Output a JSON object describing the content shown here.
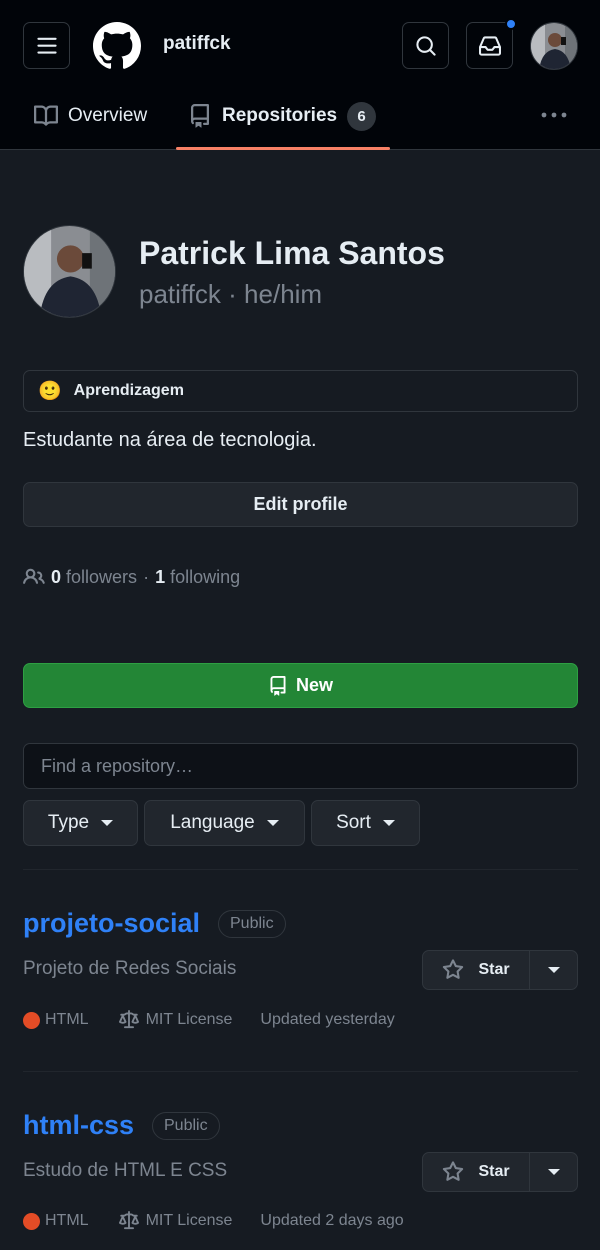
{
  "header": {
    "username": "patiffck",
    "inbox_has_unread": true
  },
  "tabs": [
    {
      "label": "Overview",
      "icon": "book-icon"
    },
    {
      "label": "Repositories",
      "icon": "repo-icon",
      "count": "6",
      "selected": true
    }
  ],
  "profile": {
    "full_name": "Patrick Lima Santos",
    "login": "patiffck",
    "pronouns": "he/him",
    "separator": "·",
    "status_emoji": "🙂",
    "status_text": "Aprendizagem",
    "bio": "Estudante na área de tecnologia.",
    "edit_label": "Edit profile",
    "followers_count": "0",
    "followers_label": "followers",
    "following_count": "1",
    "following_label": "following"
  },
  "repo_toolbar": {
    "new_label": "New",
    "search_placeholder": "Find a repository…",
    "filters": [
      "Type",
      "Language",
      "Sort"
    ]
  },
  "repos": [
    {
      "name": "projeto-social",
      "visibility": "Public",
      "description": "Projeto de Redes Sociais",
      "star_label": "Star",
      "language": "HTML",
      "language_color": "#e34c26",
      "license": "MIT License",
      "updated": "Updated yesterday"
    },
    {
      "name": "html-css",
      "visibility": "Public",
      "description": "Estudo de HTML E CSS",
      "star_label": "Star",
      "language": "HTML",
      "language_color": "#e34c26",
      "license": "MIT License",
      "updated": "Updated 2 days ago"
    }
  ],
  "colors": {
    "background": "#161b22",
    "header": "#010409",
    "link": "#2f81f7",
    "primary_button": "#238636",
    "tab_underline": "#f78166",
    "muted_text": "#7d8590"
  }
}
